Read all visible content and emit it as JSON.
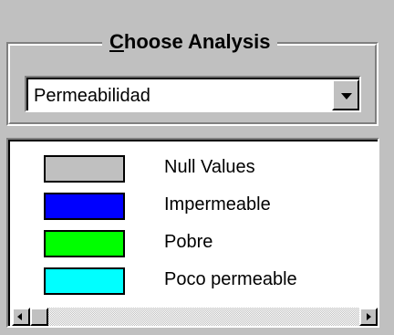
{
  "group": {
    "title_accel": "C",
    "title_rest": "hoose Analysis"
  },
  "dropdown": {
    "selected": "Permeabilidad",
    "icon": "chevron-down-icon"
  },
  "legend": {
    "items": [
      {
        "label": "Null Values",
        "color": "#c0c0c0"
      },
      {
        "label": "Impermeable",
        "color": "#0000ff"
      },
      {
        "label": "Pobre",
        "color": "#00ff00"
      },
      {
        "label": "Poco permeable",
        "color": "#00ffff"
      }
    ]
  },
  "scrollbar": {
    "left_icon": "arrow-left-icon",
    "right_icon": "arrow-right-icon"
  }
}
